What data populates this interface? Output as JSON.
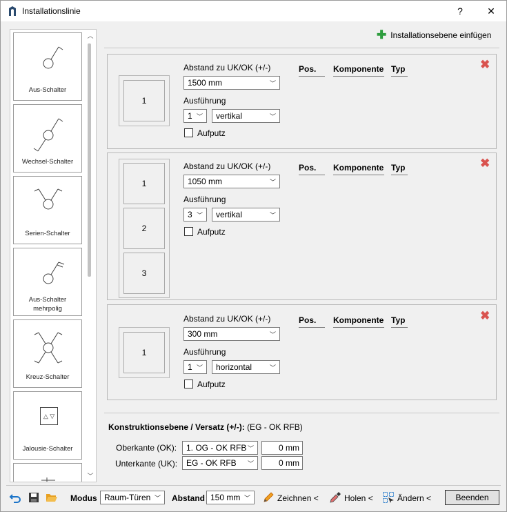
{
  "window": {
    "title": "Installationslinie",
    "help": "?",
    "close": "✕"
  },
  "palette": {
    "items": [
      {
        "label": "Aus-Schalter"
      },
      {
        "label": "Wechsel-Schalter"
      },
      {
        "label": "Serien-Schalter"
      },
      {
        "label": "Aus-Schalter mehrpolig"
      },
      {
        "label": "Kreuz-Schalter"
      },
      {
        "label": "Jalousie-Schalter",
        "glyph": "△ ▽"
      }
    ]
  },
  "add_level": {
    "label": "Installationsebene einfügen"
  },
  "levels": [
    {
      "distance_label": "Abstand zu UK/OK (+/-)",
      "distance_value": "1500 mm",
      "ausfuehrung_label": "Ausführung",
      "count_value": "1",
      "orientation_value": "vertikal",
      "aufputz_label": "Aufputz",
      "boxes": [
        "1"
      ]
    },
    {
      "distance_label": "Abstand zu UK/OK (+/-)",
      "distance_value": "1050 mm",
      "ausfuehrung_label": "Ausführung",
      "count_value": "3",
      "orientation_value": "vertikal",
      "aufputz_label": "Aufputz",
      "boxes": [
        "1",
        "2",
        "3"
      ]
    },
    {
      "distance_label": "Abstand zu UK/OK (+/-)",
      "distance_value": "300 mm",
      "ausfuehrung_label": "Ausführung",
      "count_value": "1",
      "orientation_value": "horizontal",
      "aufputz_label": "Aufputz",
      "boxes": [
        "1"
      ]
    }
  ],
  "columns": {
    "pos": "Pos.",
    "komponente": "Komponente",
    "typ": "Typ"
  },
  "konstruktion": {
    "title": "Konstruktionsebene / Versatz (+/-):",
    "subtitle": "(EG - OK RFB)",
    "oberkante_label": "Oberkante (OK):",
    "oberkante_select": "1. OG - OK RFB",
    "oberkante_value": "0 mm",
    "unterkante_label": "Unterkante (UK):",
    "unterkante_select": "EG - OK RFB",
    "unterkante_value": "0 mm"
  },
  "toolbar": {
    "modus_label": "Modus",
    "modus_value": "Raum-Türen",
    "abstand_label": "Abstand",
    "abstand_value": "150 mm",
    "zeichnen": "Zeichnen <",
    "holen": "Holen <",
    "aendern": "Ändern <",
    "beenden": "Beenden"
  },
  "colors": {
    "accent_green": "#2e9d3e",
    "delete_red": "#d9534f",
    "folder_orange": "#e8a020",
    "undo_blue": "#1a73c8"
  }
}
